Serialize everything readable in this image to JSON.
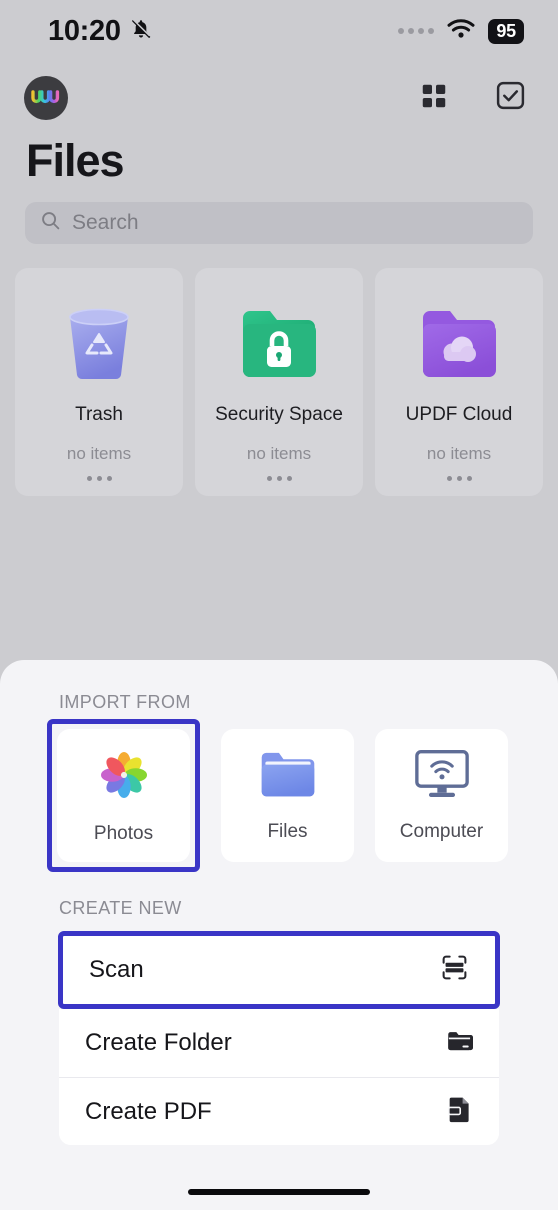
{
  "status_bar": {
    "time": "10:20",
    "silent_icon": "bell-slash-icon",
    "signal_icon": "signal-dots-icon",
    "wifi_icon": "wifi-icon",
    "battery_level": "95"
  },
  "nav": {
    "avatar_name": "user-avatar",
    "grid_view_icon": "grid-view-icon",
    "select_icon": "checkbox-select-icon"
  },
  "header": {
    "title": "Files"
  },
  "search": {
    "icon": "search-icon",
    "placeholder": "Search",
    "value": ""
  },
  "folders": [
    {
      "name": "Trash",
      "count": "no items",
      "icon": "trash-bin-icon",
      "more": "more-options-icon"
    },
    {
      "name": "Security Space",
      "count": "no items",
      "icon": "locked-folder-icon",
      "more": "more-options-icon"
    },
    {
      "name": "UPDF Cloud",
      "count": "no items",
      "icon": "cloud-folder-icon",
      "more": "more-options-icon"
    }
  ],
  "sheet": {
    "import_label": "IMPORT FROM",
    "import_options": [
      {
        "label": "Photos",
        "icon": "photos-app-icon",
        "highlighted": true
      },
      {
        "label": "Files",
        "icon": "files-app-icon",
        "highlighted": false
      },
      {
        "label": "Computer",
        "icon": "computer-wifi-icon",
        "highlighted": false
      }
    ],
    "create_label": "CREATE NEW",
    "create_options": [
      {
        "label": "Scan",
        "icon": "scan-document-icon",
        "highlighted": true
      },
      {
        "label": "Create Folder",
        "icon": "new-folder-icon",
        "highlighted": false
      },
      {
        "label": "Create PDF",
        "icon": "new-pdf-icon",
        "highlighted": false
      }
    ]
  },
  "colors": {
    "highlight": "#3a35c6",
    "sheet_bg": "#f4f4f7",
    "page_bg": "#ccccd0"
  },
  "home_indicator": "home-indicator"
}
